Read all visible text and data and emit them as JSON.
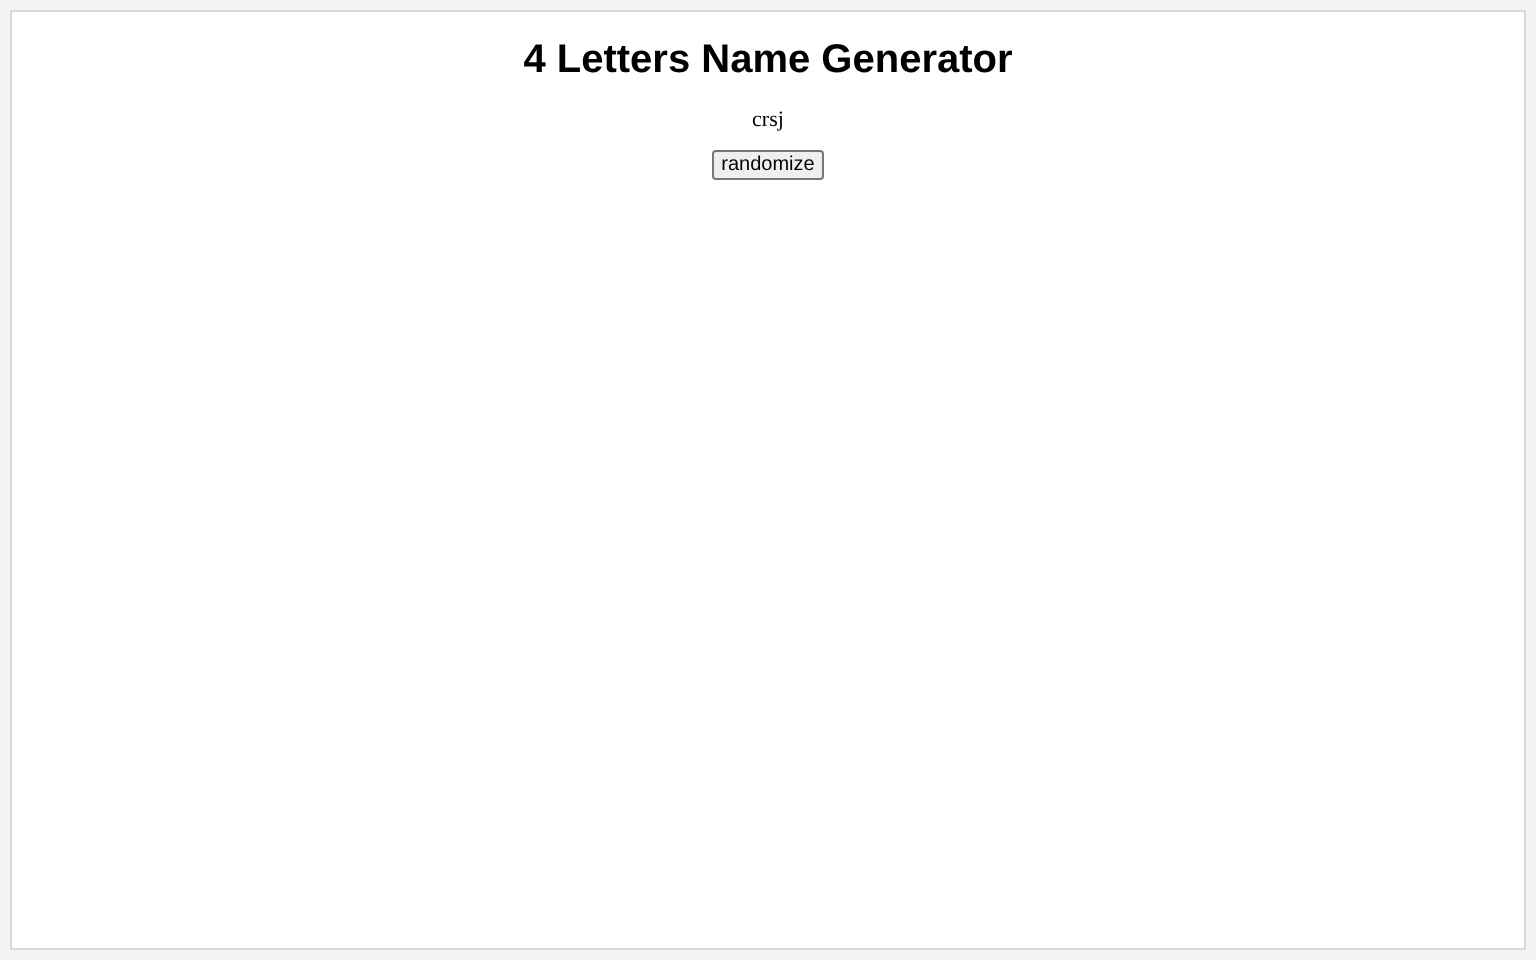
{
  "title": "4 Letters Name Generator",
  "name": "crsj",
  "button": "randomize"
}
